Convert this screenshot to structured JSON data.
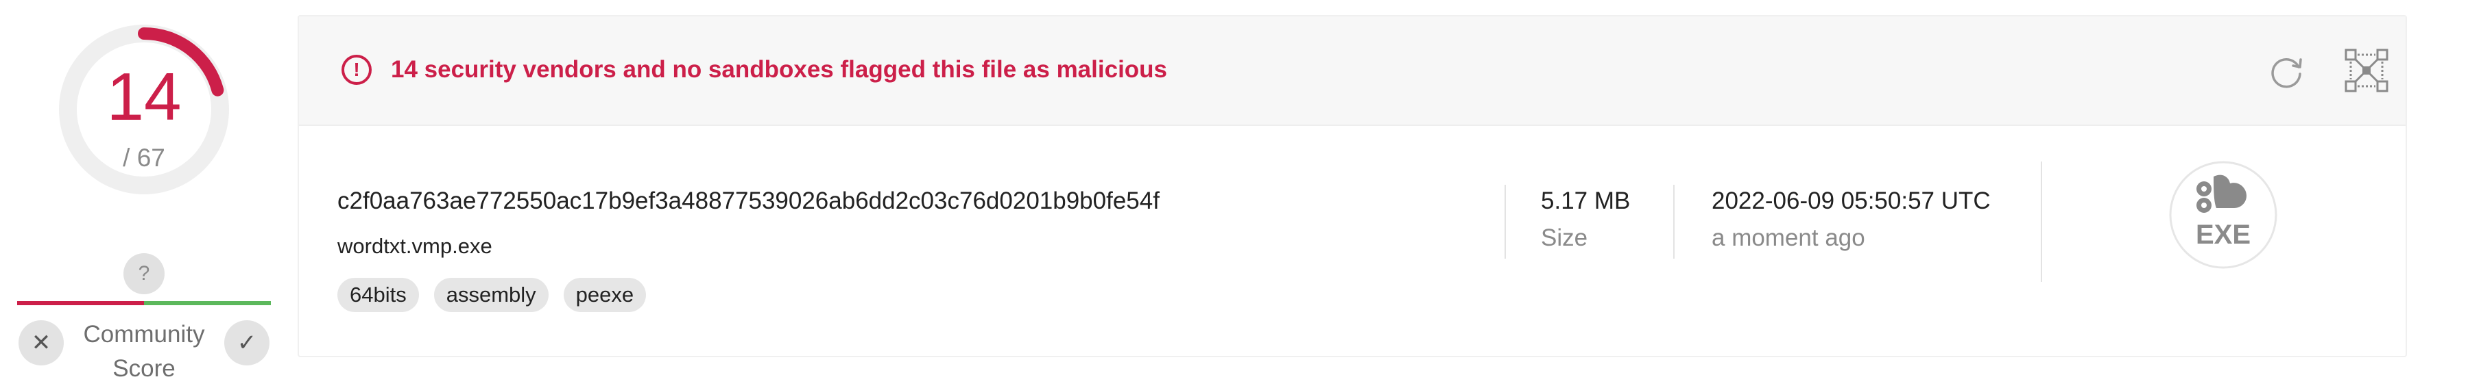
{
  "detection": {
    "score": "14",
    "total": "/ 67",
    "ratio": 0.209,
    "accent_color": "#cc1f49"
  },
  "community": {
    "help_glyph": "?",
    "label": "Community Score",
    "downvote_glyph": "✕",
    "upvote_glyph": "✓",
    "negative_color": "#cc1f49",
    "positive_color": "#5cb85c"
  },
  "alert": {
    "icon_glyph": "!",
    "message": "14 security vendors and no sandboxes flagged this file as malicious",
    "color": "#cc1f49"
  },
  "actions": {
    "reanalyze_icon": "refresh-icon",
    "similar_icon": "graph-nodes-icon"
  },
  "file": {
    "hash": "c2f0aa763ae772550ac17b9ef3a48877539026ab6dd2c03c76d0201b9b0fe54f",
    "name": "wordtxt.vmp.exe",
    "tags": [
      "64bits",
      "assembly",
      "peexe"
    ],
    "size_value": "5.17 MB",
    "size_label": "Size",
    "date_value": "2022-06-09 05:50:57 UTC",
    "date_label": "a moment ago",
    "type_label": "EXE",
    "type_icon": "exe-file-icon"
  }
}
